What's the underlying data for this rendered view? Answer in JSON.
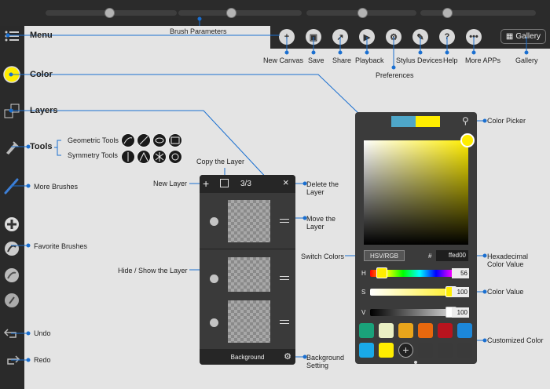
{
  "top_labels": {
    "brush_parameters": "Brush Parameters"
  },
  "sidebar": {
    "menu": "Menu",
    "color": "Color",
    "layers": "Layers",
    "tools": "Tools",
    "geometric_tools": "Geometric Tools",
    "symmetry_tools": "Symmetry Tools",
    "more_brushes": "More Brushes",
    "favorite_brushes": "Favorite Brushes",
    "undo": "Undo",
    "redo": "Redo"
  },
  "toolbar": {
    "new_canvas": "New Canvas",
    "save": "Save",
    "share": "Share",
    "playback": "Playback",
    "preferences": "Preferences",
    "stylus_devices": "Stylus Devices",
    "help": "Help",
    "more_apps": "More APPs",
    "gallery": "Gallery",
    "gallery_button": "Gallery"
  },
  "layers_panel": {
    "count": "3/3",
    "background": "Background",
    "new_layer": "New Layer",
    "copy_layer": "Copy the Layer",
    "delete_layer": "Delete the Layer",
    "move_layer": "Move the Layer",
    "hide_show": "Hide / Show the Layer",
    "background_setting": "Background Setting"
  },
  "color_panel": {
    "mode": "HSV/RGB",
    "hash": "#",
    "hex": "ffed00",
    "h_label": "H",
    "h_value": "56",
    "s_label": "S",
    "s_value": "100",
    "v_label": "V",
    "v_value": "100",
    "current_color": "#ffed00",
    "previous_color": "#4ea6c8",
    "color_picker": "Color Picker",
    "switch_colors": "Switch Colors",
    "hexadecimal": "Hexadecimal Color Value",
    "color_value": "Color Value",
    "customized_color": "Customized Color",
    "swatches": [
      "#1aa27a",
      "#eaf0c4",
      "#e9a51b",
      "#e8680d",
      "#b8141e",
      "#1c87d9",
      "#19a9e8",
      "#ffed00",
      "add-icon",
      "#3a3a3a",
      "#3a3a3a",
      "#3a3a3a"
    ]
  },
  "accent": "#1a6fd0"
}
